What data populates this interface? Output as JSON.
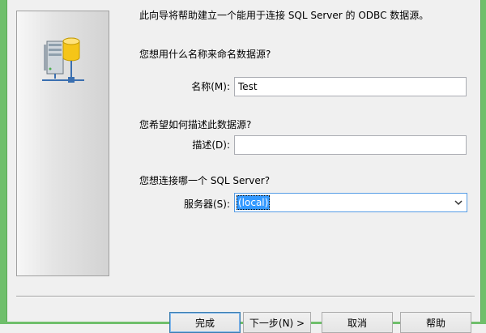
{
  "wizard": {
    "intro": "此向导将帮助建立一个能用于连接 SQL Server 的 ODBC 数据源。",
    "name_question": "您想用什么名称来命名数据源?",
    "name_label": "名称(M):",
    "name_value": "Test",
    "description_question": "您希望如何描述此数据源?",
    "description_label": "描述(D):",
    "description_value": "",
    "server_question": "您想连接哪一个 SQL Server?",
    "server_label": "服务器(S):",
    "server_value": "(local)",
    "side_icon": "database-server-network-icon"
  },
  "buttons": {
    "finish": "完成",
    "next": "下一步(N) >",
    "cancel": "取消",
    "help": "帮助"
  },
  "colors": {
    "window_frame": "#6fbf6b",
    "selection": "#3399ff",
    "focus_border": "#569de5"
  }
}
